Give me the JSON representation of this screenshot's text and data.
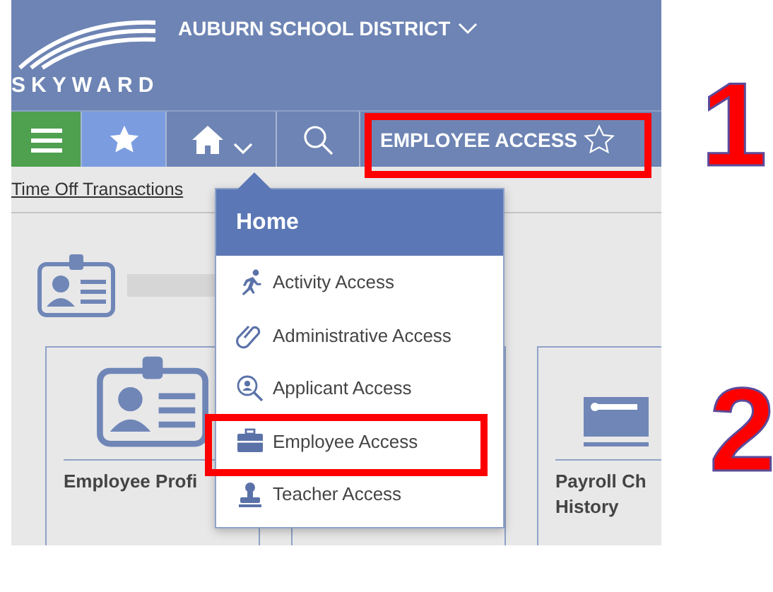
{
  "header": {
    "logo": "SKYWARD",
    "district": "AUBURN SCHOOL DISTRICT"
  },
  "nav": {
    "current": "EMPLOYEE ACCESS"
  },
  "breadcrumb": "Time Off Transactions",
  "cards": [
    {
      "kind": "profile",
      "lines": [
        "Employee Profi"
      ]
    },
    {
      "kind": "blank"
    },
    {
      "kind": "payroll",
      "lines": [
        "Payroll Ch",
        "History"
      ]
    }
  ],
  "menu": {
    "title": "Home",
    "items": [
      {
        "label": "Activity Access"
      },
      {
        "label": "Administrative Access"
      },
      {
        "label": "Applicant Access"
      },
      {
        "label": "Employee Access"
      },
      {
        "label": "Teacher Access"
      }
    ]
  },
  "annotations": [
    {
      "label": "1"
    },
    {
      "label": "2"
    }
  ]
}
